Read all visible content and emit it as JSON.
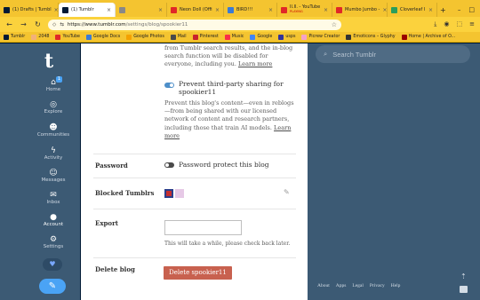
{
  "browser": {
    "tabs": [
      {
        "label": "(1) Drafts | Tumbl",
        "favicon": "tumblr-favicon",
        "color": "#001935",
        "active": false
      },
      {
        "label": "(1) Tumblr",
        "favicon": "tumblr-favicon",
        "color": "#001935",
        "active": true
      },
      {
        "label": "",
        "favicon": "site-favicon",
        "color": "#888888",
        "active": false
      },
      {
        "label": "Neon Doll (Offi",
        "favicon": "youtube-favicon",
        "color": "#e02828",
        "active": false
      },
      {
        "label": "BIRD!!!",
        "favicon": "image-favicon",
        "color": "#3a7bd5",
        "active": false
      },
      {
        "label": "Il.Il. - YouTube",
        "favicon": "youtube-favicon",
        "color": "#e02828",
        "active": false
      },
      {
        "label": "Mumbo Jumbo -",
        "favicon": "youtube-favicon",
        "color": "#e02828",
        "active": false
      },
      {
        "label": "Cloverleaf I",
        "favicon": "cloverleaf-favicon",
        "color": "#2a9d5c",
        "active": false
      }
    ],
    "playing_badge": "PLAYING",
    "url": {
      "host": "https://www.tumblr.com",
      "path": "/settings/blog/spookier11"
    },
    "bookmarks": [
      {
        "label": "Tumblr",
        "color": "#001935"
      },
      {
        "label": "2048",
        "color": "#f2b179"
      },
      {
        "label": "YouTube",
        "color": "#e02828"
      },
      {
        "label": "Google Docs",
        "color": "#3a7bd5"
      },
      {
        "label": "Google Photos",
        "color": "#f4a100"
      },
      {
        "label": "Mail",
        "color": "#4a4a4a"
      },
      {
        "label": "Pinterest",
        "color": "#c8232c"
      },
      {
        "label": "Music",
        "color": "#fa2d48"
      },
      {
        "label": "Google",
        "color": "#4285f4"
      },
      {
        "label": "usps",
        "color": "#333399"
      },
      {
        "label": "Picrew Creator",
        "color": "#f5a3c7"
      },
      {
        "label": "Emoticons – Glyphy",
        "color": "#333333"
      },
      {
        "label": "Home | Archive of O...",
        "color": "#990000"
      }
    ]
  },
  "tumblr": {
    "logo": "t",
    "nav": [
      {
        "id": "home",
        "label": "Home",
        "icon": "home-icon",
        "glyph": "⌂",
        "badge": "1"
      },
      {
        "id": "explore",
        "label": "Explore",
        "icon": "compass-icon",
        "glyph": "◎"
      },
      {
        "id": "communities",
        "label": "Communities",
        "icon": "people-icon",
        "glyph": "☻"
      },
      {
        "id": "activity",
        "label": "Activity",
        "icon": "lightning-icon",
        "glyph": "ϟ"
      },
      {
        "id": "messages",
        "label": "Messages",
        "icon": "chat-bubble-icon",
        "glyph": "☺"
      },
      {
        "id": "inbox",
        "label": "Inbox",
        "icon": "envelope-icon",
        "glyph": "✉"
      },
      {
        "id": "account",
        "label": "Account",
        "icon": "person-icon",
        "glyph": "●"
      },
      {
        "id": "settings",
        "label": "Settings",
        "icon": "gear-icon",
        "glyph": "⚙"
      }
    ]
  },
  "settings": {
    "search_intro": "from Tumblr search results, and the in-blog search function will be disabled for everyone, including you.",
    "learn_more": "Learn more",
    "third_party": {
      "enabled": true,
      "label": "Prevent third-party sharing for spookier11",
      "description": "Prevent this blog's content—even in reblogs—from being shared with our licensed network of content and research partners, including those that train AI models."
    },
    "password": {
      "row_label": "Password",
      "toggle_label": "Password protect this blog",
      "enabled": false
    },
    "blocked": {
      "row_label": "Blocked Tumblrs"
    },
    "export": {
      "row_label": "Export",
      "placeholder": "",
      "note": "This will take a while, please check back later."
    },
    "delete": {
      "row_label": "Delete blog",
      "button": "Delete spookier11"
    }
  },
  "right": {
    "search_placeholder": "Search Tumblr",
    "footer": [
      "About",
      "Apps",
      "Legal",
      "Privacy",
      "Help"
    ]
  }
}
